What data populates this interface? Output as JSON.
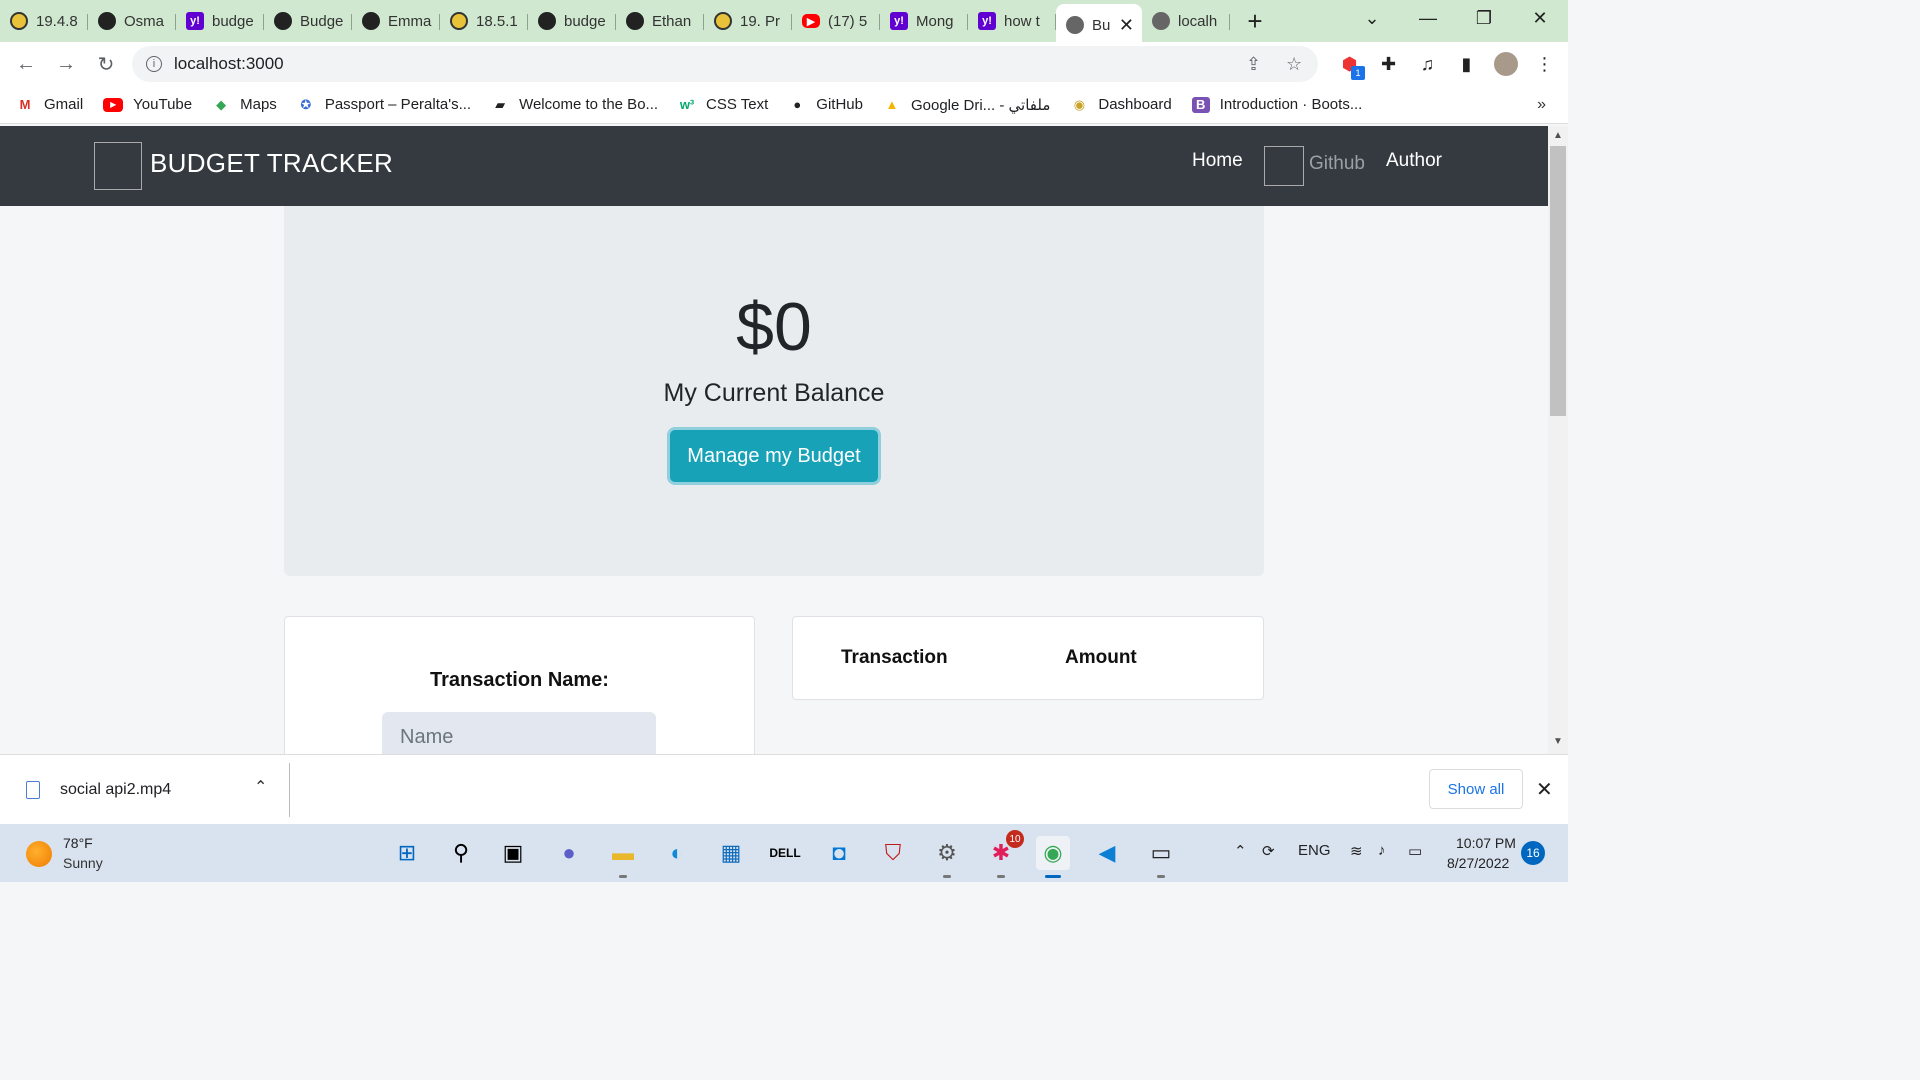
{
  "browser": {
    "tabs": [
      {
        "label": "19.4.8",
        "icon": "ext"
      },
      {
        "label": "Osma",
        "icon": "gh"
      },
      {
        "label": "budge",
        "icon": "yh"
      },
      {
        "label": "Budge",
        "icon": "gh"
      },
      {
        "label": "Emma",
        "icon": "gh"
      },
      {
        "label": "18.5.1",
        "icon": "ext"
      },
      {
        "label": "budge",
        "icon": "gh"
      },
      {
        "label": "Ethan",
        "icon": "gh"
      },
      {
        "label": "19. Pr",
        "icon": "ext"
      },
      {
        "label": "(17) 5",
        "icon": "yt"
      },
      {
        "label": "Mong",
        "icon": "yh"
      },
      {
        "label": "how t",
        "icon": "yh"
      },
      {
        "label": "Bu",
        "icon": "globe",
        "active": true
      },
      {
        "label": "localh",
        "icon": "globe"
      }
    ],
    "url": "localhost:3000",
    "bookmarks": [
      {
        "label": "Gmail",
        "icon": "gmail-icon"
      },
      {
        "label": "YouTube",
        "icon": "youtube-icon"
      },
      {
        "label": "Maps",
        "icon": "maps-icon"
      },
      {
        "label": "Passport – Peralta's...",
        "icon": "passport-icon"
      },
      {
        "label": "Welcome to the Bo...",
        "icon": "book-icon"
      },
      {
        "label": "CSS Text",
        "icon": "w3schools-icon"
      },
      {
        "label": "GitHub",
        "icon": "github-icon"
      },
      {
        "label": "Google Dri... - ملفاتي",
        "icon": "drive-icon"
      },
      {
        "label": "Dashboard",
        "icon": "dashboard-icon"
      },
      {
        "label": "Introduction · Boots...",
        "icon": "bootstrap-icon"
      }
    ],
    "bookmarks_more": "»",
    "extension_badge": "1"
  },
  "app": {
    "brand": "BUDGET TRACKER",
    "nav": {
      "home": "Home",
      "github": "Github",
      "author": "Author"
    },
    "balance": "$0",
    "balance_label": "My Current Balance",
    "manage_button": "Manage my Budget",
    "form": {
      "transaction_name_label": "Transaction Name:",
      "name_placeholder": "Name"
    },
    "table": {
      "headers": [
        "Transaction",
        "Amount"
      ]
    }
  },
  "downloads": {
    "file": "social api2.mp4",
    "show_all": "Show all"
  },
  "taskbar": {
    "weather_temp": "78°F",
    "weather_desc": "Sunny",
    "language": "ENG",
    "time": "10:07 PM",
    "date": "8/27/2022",
    "notifications": "16",
    "slack_badge": "10"
  },
  "colors": {
    "navbar": "#343a40",
    "accent_button": "#17a2b8",
    "jumbotron": "#e9ecef",
    "tabstrip": "#cfe8cf"
  }
}
